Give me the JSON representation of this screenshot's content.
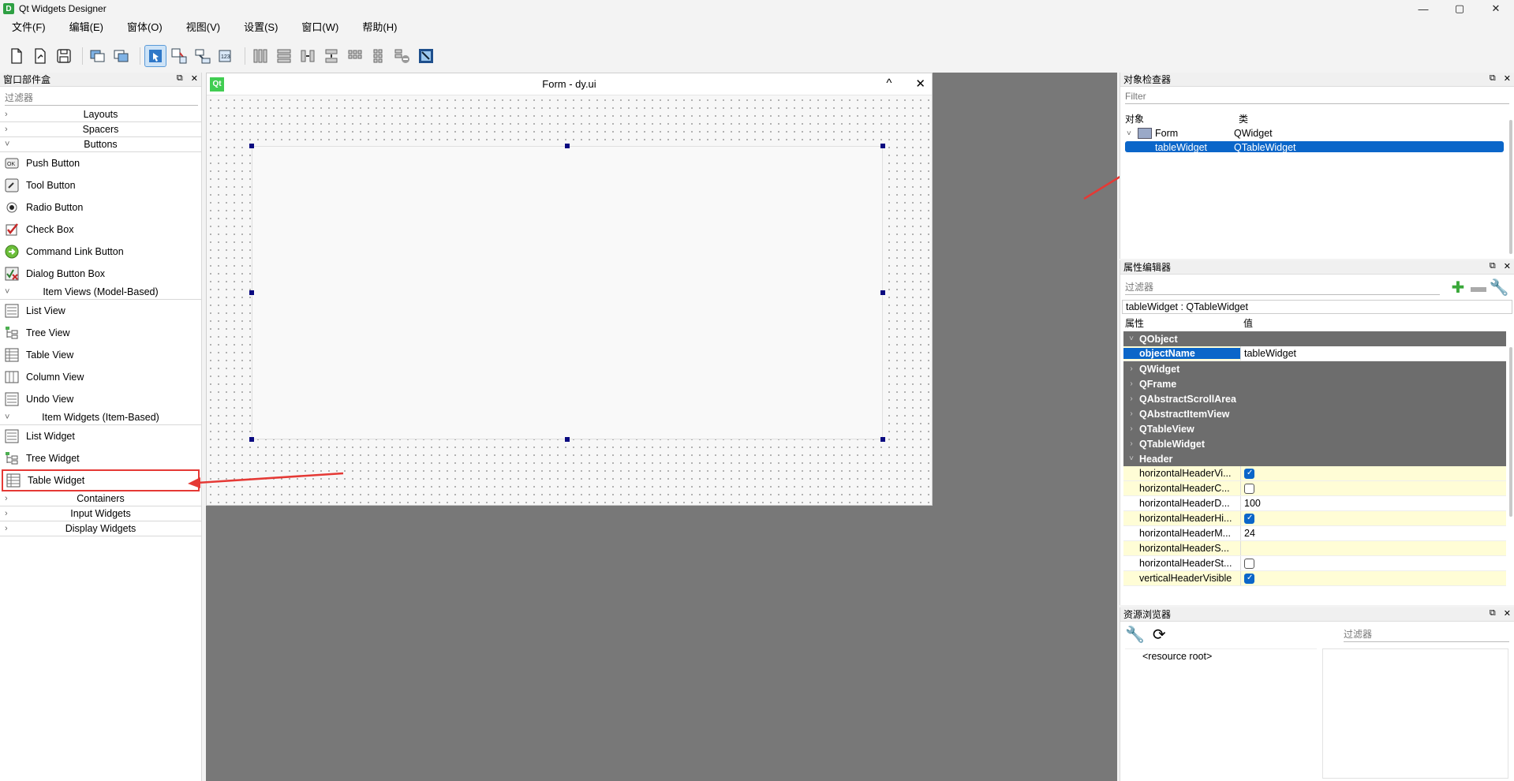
{
  "app": {
    "title": "Qt Widgets Designer",
    "icon_letter": "D",
    "window_controls": {
      "minimize": "—",
      "maximize": "▢",
      "close": "✕"
    }
  },
  "menu": [
    "文件(F)",
    "编辑(E)",
    "窗体(O)",
    "视图(V)",
    "设置(S)",
    "窗口(W)",
    "帮助(H)"
  ],
  "toolbar_icons": [
    "new-file-icon",
    "open-file-icon",
    "save-icon",
    "send-to-back-icon",
    "bring-to-front-icon",
    "edit-widgets-icon",
    "edit-signals-slots-icon",
    "edit-buddies-icon",
    "edit-tab-order-icon",
    "lay-out-horizontally-icon",
    "lay-out-vertically-icon",
    "lay-out-horizontal-splitter-icon",
    "lay-out-vertical-splitter-icon",
    "lay-out-grid-icon",
    "lay-out-form-icon",
    "break-layout-icon",
    "adjust-size-icon"
  ],
  "widget_box": {
    "title": "窗口部件盒",
    "filter_placeholder": "过滤器",
    "categories": {
      "layouts": "Layouts",
      "spacers": "Spacers",
      "buttons": "Buttons",
      "item_views": "Item Views (Model-Based)",
      "item_widgets": "Item Widgets (Item-Based)",
      "containers": "Containers",
      "input_widgets": "Input Widgets",
      "display_widgets": "Display Widgets"
    },
    "buttons": [
      "Push Button",
      "Tool Button",
      "Radio Button",
      "Check Box",
      "Command Link Button",
      "Dialog Button Box"
    ],
    "item_views": [
      "List View",
      "Tree View",
      "Table View",
      "Column View",
      "Undo View"
    ],
    "item_widgets": [
      "List Widget",
      "Tree Widget",
      "Table Widget"
    ]
  },
  "form": {
    "title": "Form - dy.ui",
    "badge": "Qt",
    "collapse": "^",
    "close": "✕"
  },
  "object_inspector": {
    "title": "对象检查器",
    "filter_placeholder": "Filter",
    "col_object": "对象",
    "col_class": "类",
    "rows": [
      {
        "name": "Form",
        "class": "QWidget"
      },
      {
        "name": "tableWidget",
        "class": "QTableWidget"
      }
    ]
  },
  "property_editor": {
    "title": "属性编辑器",
    "filter_placeholder": "过滤器",
    "object_line": "tableWidget : QTableWidget",
    "col_property": "属性",
    "col_value": "值",
    "groups": {
      "qobject": "QObject",
      "qwidget": "QWidget",
      "qframe": "QFrame",
      "qabstractscrollarea": "QAbstractScrollArea",
      "qabstractitemview": "QAbstractItemView",
      "qtableview": "QTableView",
      "qtablewidget": "QTableWidget",
      "header": "Header"
    },
    "object_name": {
      "name": "objectName",
      "value": "tableWidget"
    },
    "header_props": [
      {
        "name": "horizontalHeaderVi...",
        "value": "",
        "checkbox": true,
        "checked": true
      },
      {
        "name": "horizontalHeaderC...",
        "value": "",
        "checkbox": true,
        "checked": false
      },
      {
        "name": "horizontalHeaderD...",
        "value": "100",
        "checkbox": false
      },
      {
        "name": "horizontalHeaderHi...",
        "value": "",
        "checkbox": true,
        "checked": true
      },
      {
        "name": "horizontalHeaderM...",
        "value": "24",
        "checkbox": false
      },
      {
        "name": "horizontalHeaderS...",
        "value": "",
        "checkbox": false
      },
      {
        "name": "horizontalHeaderSt...",
        "value": "",
        "checkbox": true,
        "checked": false
      },
      {
        "name": "verticalHeaderVisible",
        "value": "",
        "checkbox": true,
        "checked": true
      }
    ]
  },
  "resource_browser": {
    "title": "资源浏览器",
    "filter_placeholder": "过滤器",
    "root": "<resource root>"
  },
  "colors": {
    "selection": "#0b66c9",
    "mdi_background": "#787878",
    "highlight_red": "#e53935",
    "property_group": "#6d6d6d",
    "property_row": "#fffdd6"
  }
}
